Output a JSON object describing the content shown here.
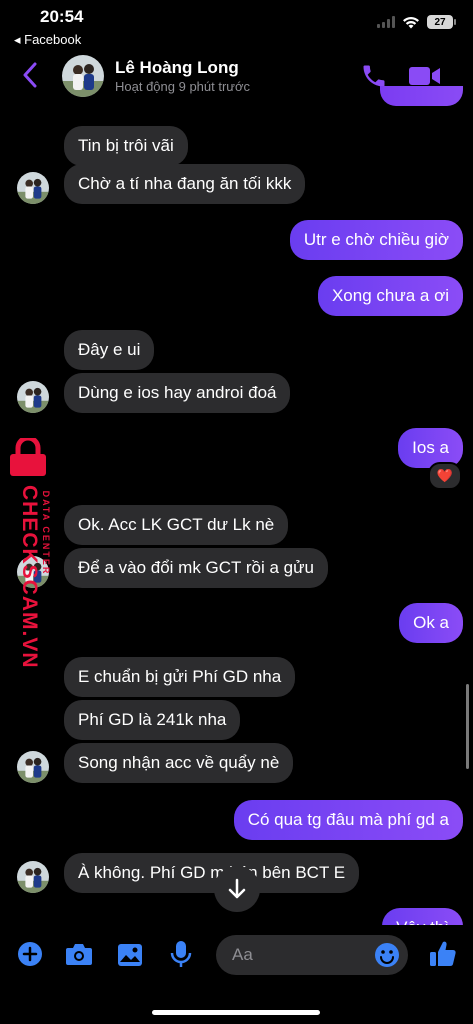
{
  "status_bar": {
    "time": "20:54",
    "back_app": "◂ Facebook",
    "battery": "27"
  },
  "header": {
    "contact_name": "Lê Hoàng Long",
    "contact_status": "Hoạt động 9 phút trước",
    "accent_color": "#8a4bf5"
  },
  "messages": [
    {
      "side": "in",
      "text": "Tin bị trôi vãi"
    },
    {
      "side": "in",
      "text": "Chờ a tí nha đang ăn tối kkk"
    },
    {
      "side": "out",
      "text": "Utr e chờ chiều giờ"
    },
    {
      "side": "out",
      "text": "Xong chưa a ơi"
    },
    {
      "side": "in",
      "text": "Đây e ui"
    },
    {
      "side": "in",
      "text": "Dùng e ios hay androi đoá"
    },
    {
      "side": "out",
      "text": "Ios a",
      "reaction": "❤️"
    },
    {
      "side": "in",
      "text": "Ok. Acc LK GCT dư Lk nè"
    },
    {
      "side": "in",
      "text": "Để a vào đổi mk GCT rồi a gửu"
    },
    {
      "side": "out",
      "text": "Ok a"
    },
    {
      "side": "in",
      "text": "E chuẩn bị gửi Phí GD nha"
    },
    {
      "side": "in",
      "text": "Phí GD là 241k nha"
    },
    {
      "side": "in",
      "text": "Song nhận acc về quẩy nè"
    },
    {
      "side": "out",
      "text": "Có qua tg đâu mà phí gd a"
    },
    {
      "side": "in",
      "text": "À không. Phí GD m    bán bên BCT E"
    },
    {
      "side": "out",
      "text": "Vậy thì"
    }
  ],
  "watermark": {
    "brand": "CHECKSCAM.VN",
    "sub": "DATA CENTER"
  },
  "composer": {
    "placeholder": "Aa"
  },
  "colors": {
    "outgoing_start": "#6a3df0",
    "outgoing_end": "#8b4cf6",
    "incoming": "#2c2c2e",
    "watermark": "#e8123c"
  }
}
